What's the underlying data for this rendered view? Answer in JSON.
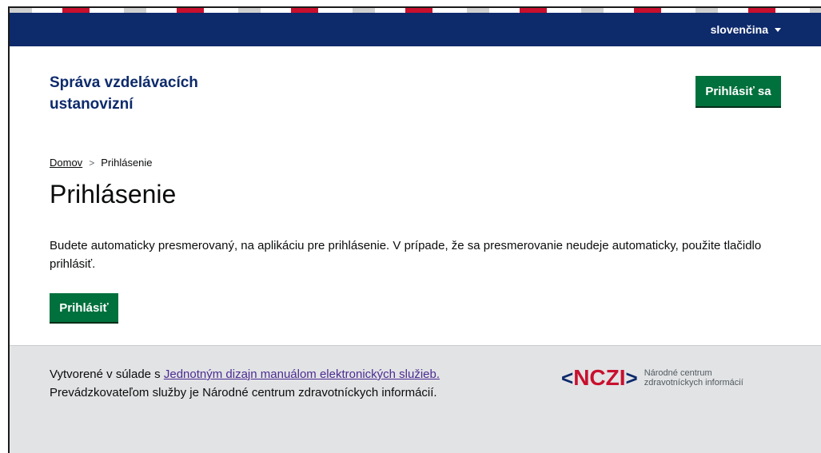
{
  "colors": {
    "topbar": "#0d2a6b",
    "brand_text": "#0d2a6b",
    "primary_button": "#00703c",
    "footer_bg": "#e2e3e5",
    "link_visited": "#4c2c92",
    "nczi_red": "#c8102e"
  },
  "topbar": {
    "language": "slovenčina",
    "language_icon": "caret-down-icon"
  },
  "header": {
    "brand": "Správa vzdelávacích ustanovizní",
    "login_button": "Prihlásiť sa"
  },
  "breadcrumb": {
    "items": [
      {
        "label": "Domov"
      },
      {
        "label": "Prihlásenie"
      }
    ],
    "separator": ">"
  },
  "main": {
    "title": "Prihlásenie",
    "description": "Budete automaticky presmerovaný, na aplikáciu pre prihlásenie. V prípade, že sa presmerovanie neudeje automaticky, použite tlačidlo prihlásiť.",
    "login_button": "Prihlásiť"
  },
  "footer": {
    "created_prefix": "Vytvorené v súlade s ",
    "created_link": "Jednotným dizajn manuálom elektronických služieb.",
    "operator": "Prevádzkovateľom služby je Národné centrum zdravotníckych informácií.",
    "logo": {
      "mark_left": "<",
      "mark_text": "NCZI",
      "mark_right": ">",
      "line1": "Národné centrum",
      "line2": "zdravotníckych informácií"
    }
  }
}
